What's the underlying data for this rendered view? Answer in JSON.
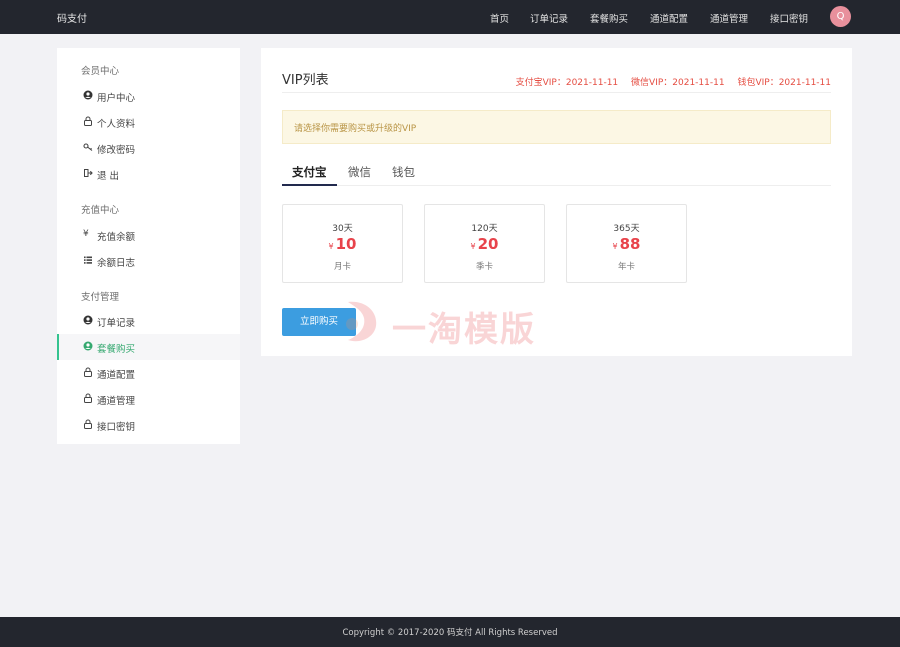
{
  "header": {
    "brand": "码支付",
    "nav": [
      "首页",
      "订单记录",
      "套餐购买",
      "通道配置",
      "通道管理",
      "接口密钥"
    ],
    "avatar_letter": "Q"
  },
  "sidebar": {
    "sections": [
      {
        "title": "会员中心",
        "items": [
          {
            "label": "用户中心",
            "icon": "user-circle-icon"
          },
          {
            "label": "个人资料",
            "icon": "lock-icon"
          },
          {
            "label": "修改密码",
            "icon": "key-icon"
          },
          {
            "label": "退 出",
            "icon": "logout-icon"
          }
        ]
      },
      {
        "title": "充值中心",
        "items": [
          {
            "label": "充值余额",
            "icon": "yen-icon"
          },
          {
            "label": "余额日志",
            "icon": "list-icon"
          }
        ]
      },
      {
        "title": "支付管理",
        "items": [
          {
            "label": "订单记录",
            "icon": "user-circle-icon"
          },
          {
            "label": "套餐购买",
            "icon": "user-circle-icon",
            "active": true
          },
          {
            "label": "通道配置",
            "icon": "lock-icon"
          },
          {
            "label": "通道管理",
            "icon": "lock-icon"
          },
          {
            "label": "接口密钥",
            "icon": "lock-icon"
          }
        ]
      }
    ]
  },
  "main": {
    "title": "VIP列表",
    "vip_status": [
      "支付宝VIP：2021-11-11",
      "微信VIP：2021-11-11",
      "钱包VIP：2021-11-11"
    ],
    "alert": "请选择你需要购买或升级的VIP",
    "tabs": [
      "支付宝",
      "微信",
      "钱包"
    ],
    "plans": [
      {
        "days": "30天",
        "currency": "¥",
        "price": "10",
        "name": "月卡"
      },
      {
        "days": "120天",
        "currency": "¥",
        "price": "20",
        "name": "季卡"
      },
      {
        "days": "365天",
        "currency": "¥",
        "price": "88",
        "name": "年卡"
      }
    ],
    "buy_label": "立即购买"
  },
  "watermark": "一淘模版",
  "footer": "Copyright © 2017-2020 码支付 All Rights Reserved",
  "colors": {
    "accent": "#3c9de0",
    "danger": "#e8434b",
    "active": "#34a86f",
    "nav_bg": "#23262e"
  }
}
